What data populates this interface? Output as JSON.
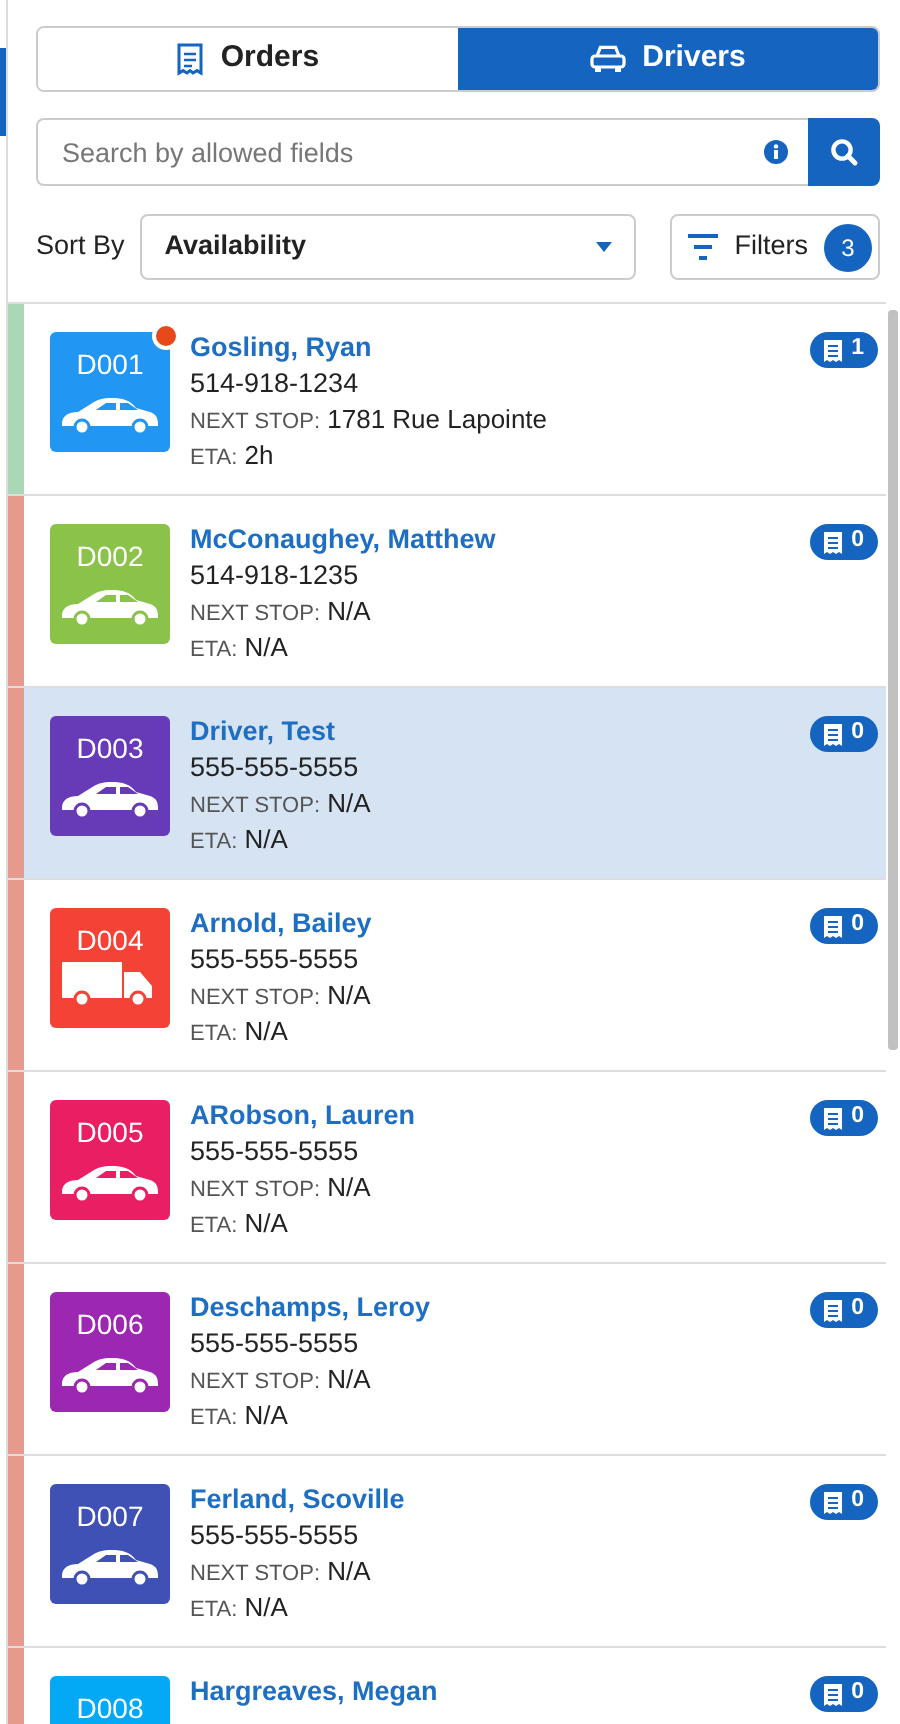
{
  "tabs": [
    {
      "label": "Orders",
      "kind": "orders",
      "selected": false
    },
    {
      "label": "Drivers",
      "kind": "car",
      "selected": true
    }
  ],
  "search": {
    "placeholder": "Search by allowed fields"
  },
  "sort": {
    "label": "Sort By",
    "value": "Availability"
  },
  "filters": {
    "label": "Filters",
    "count": "3"
  },
  "drivers": [
    {
      "code": "D001",
      "name": "Gosling, Ryan",
      "phone": "514-918-1234",
      "next_stop_label": "NEXT STOP:",
      "next_stop": "1781 Rue Lapointe",
      "eta_label": "ETA:",
      "eta": "2h",
      "orders": "1",
      "kind": "car",
      "color": "#2196f3",
      "available": true,
      "alert": true,
      "selected": false
    },
    {
      "code": "D002",
      "name": "McConaughey, Matthew",
      "phone": "514-918-1235",
      "next_stop_label": "NEXT STOP:",
      "next_stop": "N/A",
      "eta_label": "ETA:",
      "eta": "N/A",
      "orders": "0",
      "kind": "car",
      "color": "#8bc34a",
      "available": false,
      "alert": false,
      "selected": false
    },
    {
      "code": "D003",
      "name": "Driver, Test",
      "phone": "555-555-5555",
      "next_stop_label": "NEXT STOP:",
      "next_stop": "N/A",
      "eta_label": "ETA:",
      "eta": "N/A",
      "orders": "0",
      "kind": "car",
      "color": "#673ab7",
      "available": false,
      "alert": false,
      "selected": true
    },
    {
      "code": "D004",
      "name": "Arnold, Bailey",
      "phone": "555-555-5555",
      "next_stop_label": "NEXT STOP:",
      "next_stop": "N/A",
      "eta_label": "ETA:",
      "eta": "N/A",
      "orders": "0",
      "kind": "truck",
      "color": "#f44336",
      "available": false,
      "alert": false,
      "selected": false
    },
    {
      "code": "D005",
      "name": "ARobson, Lauren",
      "phone": "555-555-5555",
      "next_stop_label": "NEXT STOP:",
      "next_stop": "N/A",
      "eta_label": "ETA:",
      "eta": "N/A",
      "orders": "0",
      "kind": "car",
      "color": "#e91e63",
      "available": false,
      "alert": false,
      "selected": false
    },
    {
      "code": "D006",
      "name": "Deschamps, Leroy",
      "phone": "555-555-5555",
      "next_stop_label": "NEXT STOP:",
      "next_stop": "N/A",
      "eta_label": "ETA:",
      "eta": "N/A",
      "orders": "0",
      "kind": "car",
      "color": "#9c27b0",
      "available": false,
      "alert": false,
      "selected": false
    },
    {
      "code": "D007",
      "name": "Ferland, Scoville",
      "phone": "555-555-5555",
      "next_stop_label": "NEXT STOP:",
      "next_stop": "N/A",
      "eta_label": "ETA:",
      "eta": "N/A",
      "orders": "0",
      "kind": "car",
      "color": "#3f51b5",
      "available": false,
      "alert": false,
      "selected": false
    },
    {
      "code": "D008",
      "name": "Hargreaves, Megan",
      "orders": "0",
      "color": "#03a9f4",
      "available": false,
      "alert": false,
      "selected": false
    }
  ]
}
